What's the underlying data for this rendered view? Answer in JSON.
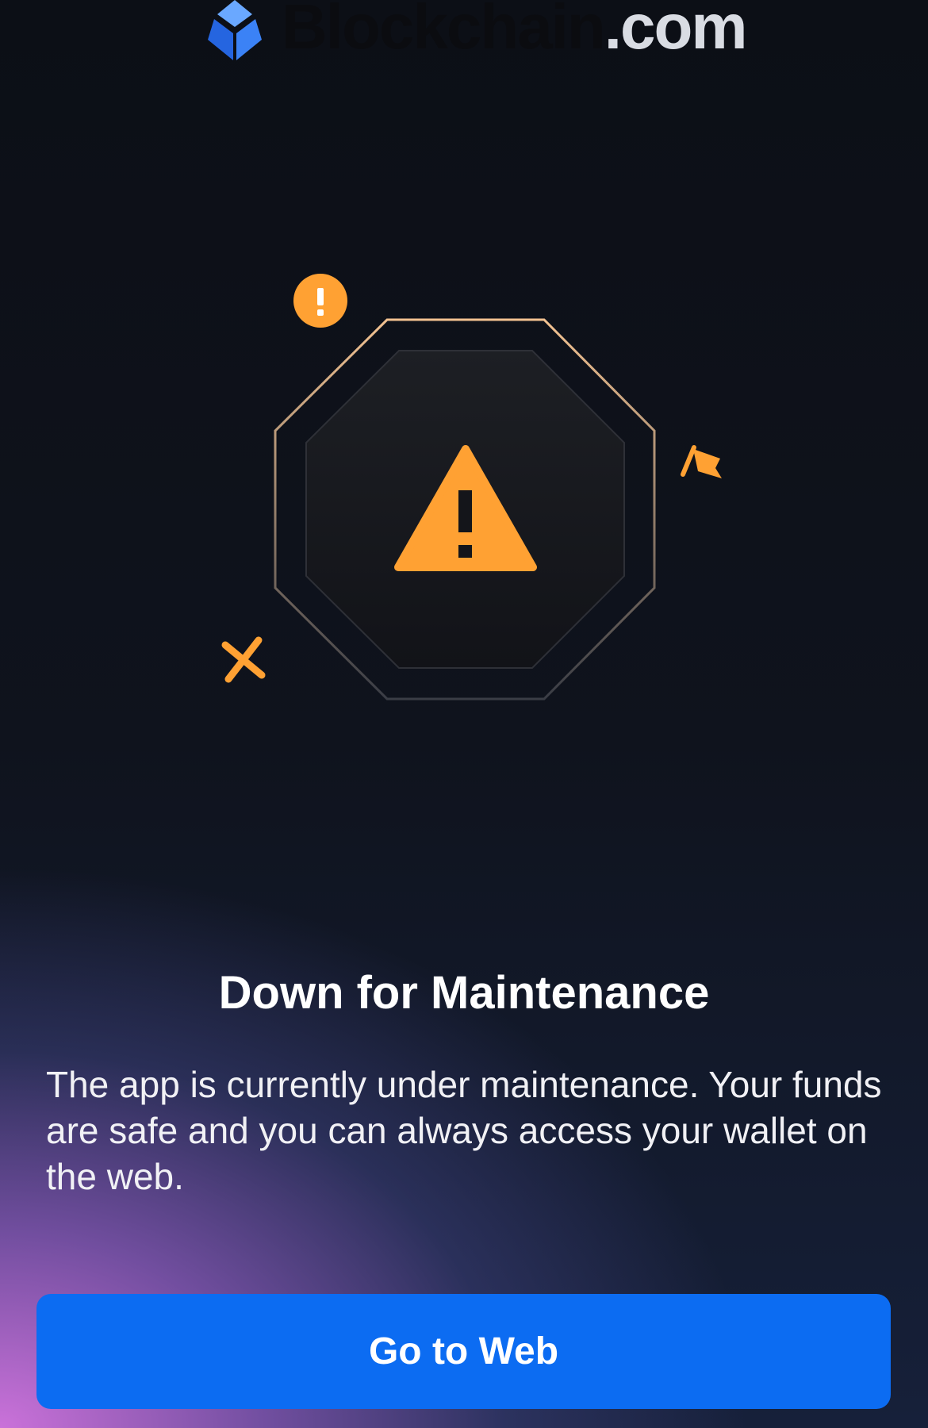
{
  "header": {
    "logo_icon": "blockchain-cube-icon",
    "brand_text": "Blockchain",
    "brand_tld": ".com"
  },
  "illustration": {
    "icons": [
      "warning-triangle-icon",
      "exclamation-badge-icon",
      "flag-icon",
      "x-mark-icon"
    ],
    "accent_color": "#ffa133"
  },
  "maintenance": {
    "title": "Down for Maintenance",
    "description": "The app is currently under maintenance. Your funds are safe and you can always access your wallet on the web.",
    "button_label": "Go to Web"
  },
  "colors": {
    "background": "#0c0f16",
    "button": "#0c6cf2",
    "brand_blue": "#2d7ff9"
  }
}
